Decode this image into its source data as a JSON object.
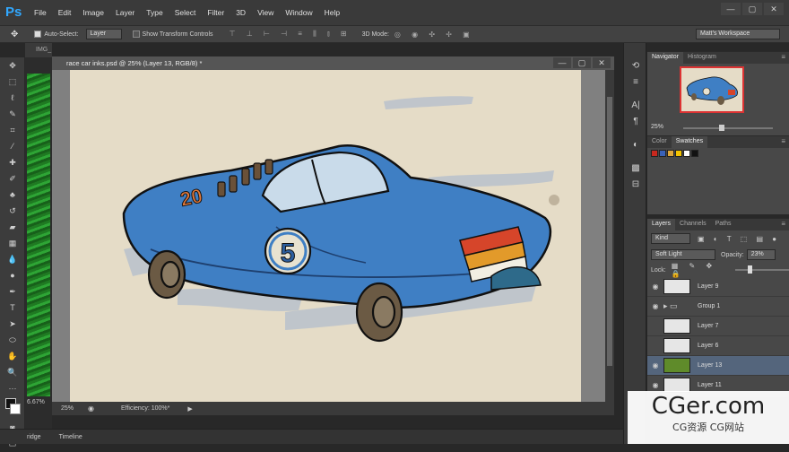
{
  "app": {
    "logo": "Ps"
  },
  "menu": [
    "File",
    "Edit",
    "Image",
    "Layer",
    "Type",
    "Select",
    "Filter",
    "3D",
    "View",
    "Window",
    "Help"
  ],
  "window_controls": [
    "—",
    "▢",
    "✕"
  ],
  "options_bar": {
    "auto_select_label": "Auto-Select:",
    "auto_select_value": "Layer",
    "show_transform_label": "Show Transform Controls",
    "mode_3d_label": "3D Mode:",
    "workspace": "Matt's Workspace"
  },
  "bg_doc_tab": "IMG_",
  "bg_doc_zoom": "6.67%",
  "document": {
    "title": "race car inks.psd @ 25% (Layer 13, RGB/8) *",
    "zoom": "25%",
    "efficiency": "Efficiency: 100%*",
    "car_number": "5",
    "car_text": "20"
  },
  "bottom_tabs": [
    "ridge",
    "Timeline"
  ],
  "navigator": {
    "tabs": [
      "Navigator",
      "Histogram"
    ],
    "zoom": "25%"
  },
  "color_panel": {
    "tabs": [
      "Color",
      "Swatches"
    ],
    "swatches": [
      "#c8281e",
      "#3a62b8",
      "#e0a83a",
      "#f2c200",
      "#ffffff",
      "#111111"
    ]
  },
  "layers_panel": {
    "tabs": [
      "Layers",
      "Channels",
      "Paths"
    ],
    "filter_kind": "Kind",
    "blend_mode": "Soft Light",
    "opacity_label": "Opacity:",
    "opacity_value": "23%",
    "lock_label": "Lock:",
    "layers": [
      {
        "name": "Layer 9",
        "visible": true,
        "selected": false
      },
      {
        "name": "Group 1",
        "visible": true,
        "selected": false
      },
      {
        "name": "Layer 7",
        "visible": false,
        "selected": false
      },
      {
        "name": "Layer 6",
        "visible": false,
        "selected": false
      },
      {
        "name": "Layer 13",
        "visible": true,
        "selected": true
      },
      {
        "name": "Layer 11",
        "visible": true,
        "selected": false
      }
    ]
  },
  "watermark": {
    "main": "CGer.com",
    "sub": "CG资源 CG网站"
  },
  "colors": {
    "accent": "#31a8ff",
    "selection": "#54657c",
    "paper": "#e5dcc7",
    "car_blue": "#3f7fc4"
  }
}
